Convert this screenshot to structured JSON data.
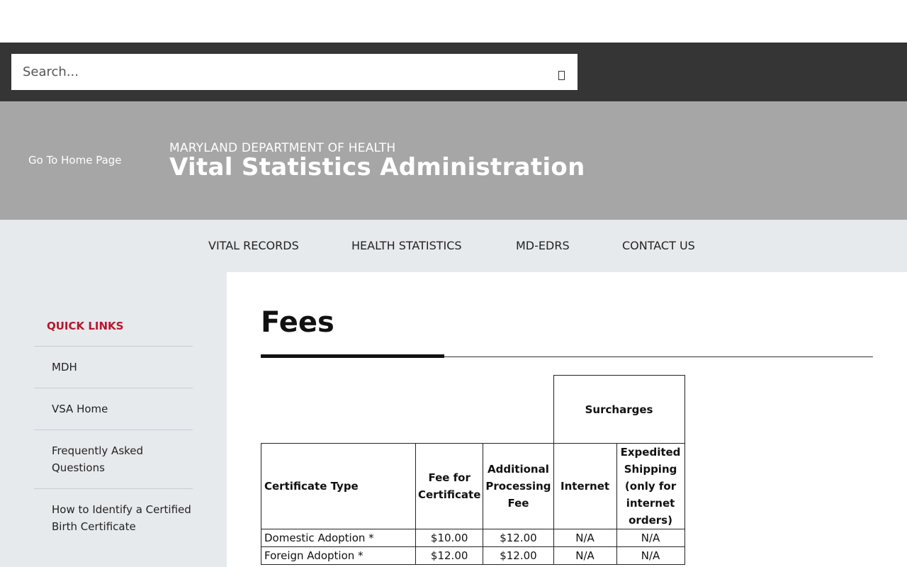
{
  "search": {
    "placeholder": "Search...",
    "button_icon": "search-icon"
  },
  "header": {
    "logo_alt": "Go To Home Page",
    "department": "MARYLAND DEPARTMENT OF HEALTH",
    "agency": "Vital Statistics Administration"
  },
  "nav": {
    "items": [
      {
        "label": "VITAL RECORDS"
      },
      {
        "label": "HEALTH STATISTICS"
      },
      {
        "label": "MD-EDRS"
      },
      {
        "label": "CONTACT US"
      }
    ]
  },
  "sidebar": {
    "heading": "QUICK LINKS",
    "items": [
      {
        "label": "MDH"
      },
      {
        "label": "VSA Home"
      },
      {
        "label": "Frequently Asked Questions"
      },
      {
        "label": "How to Identify a Certified Birth Certificate"
      }
    ]
  },
  "page": {
    "title": "Fees"
  },
  "fees_table": {
    "group_header": "Surcharges",
    "headers": [
      "Certificate Type",
      "Fee for Certificate",
      "Additional Processing Fee",
      "Internet",
      "Expedited Shipping (only for internet orders)"
    ],
    "rows": [
      [
        "Domestic Adoption *",
        "$10.00",
        "$12.00",
        "N/A",
        "N/A"
      ],
      [
        "Foreign Adoption *",
        "$12.00",
        "$12.00",
        "N/A",
        "N/A"
      ]
    ]
  },
  "colors": {
    "topbar": "#353535",
    "banner": "#a6a6a6",
    "nav": "#e7eaed",
    "quicklinks_heading": "#b5172e"
  }
}
